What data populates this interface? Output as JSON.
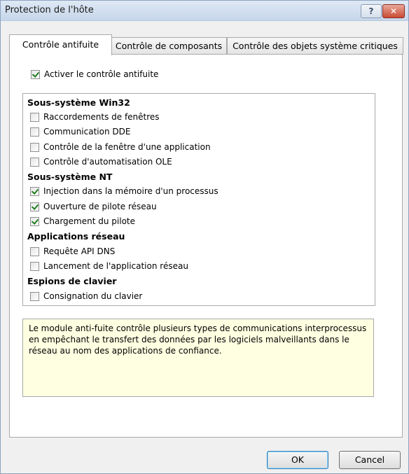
{
  "window": {
    "title": "Protection de l'hôte",
    "help_label": "?",
    "close_label": "✕"
  },
  "tabs": [
    {
      "label": "Contrôle antifuite",
      "active": true
    },
    {
      "label": "Contrôle de composants",
      "active": false
    },
    {
      "label": "Contrôle des objets système critiques",
      "active": false
    }
  ],
  "enable": {
    "label": "Activer le contrôle antifuite",
    "checked": true
  },
  "groups": [
    {
      "title": "Sous-système Win32",
      "items": [
        {
          "label": "Raccordements de fenêtres",
          "checked": false
        },
        {
          "label": "Communication DDE",
          "checked": false
        },
        {
          "label": "Contrôle de la fenêtre d'une application",
          "checked": false
        },
        {
          "label": "Contrôle d'automatisation OLE",
          "checked": false
        }
      ]
    },
    {
      "title": "Sous-système NT",
      "items": [
        {
          "label": "Injection dans la mémoire d'un processus",
          "checked": true
        },
        {
          "label": "Ouverture de pilote réseau",
          "checked": true
        },
        {
          "label": "Chargement du pilote",
          "checked": true
        }
      ]
    },
    {
      "title": "Applications réseau",
      "items": [
        {
          "label": "Requête API DNS",
          "checked": false
        },
        {
          "label": "Lancement de l'application réseau",
          "checked": false
        }
      ]
    },
    {
      "title": "Espions de clavier",
      "items": [
        {
          "label": "Consignation du clavier",
          "checked": false
        }
      ]
    }
  ],
  "description": "Le module anti-fuite contrôle plusieurs types de communications interprocessus en empêchant le transfert des données par les logiciels malveillants dans le réseau au nom des applications de confiance.",
  "buttons": {
    "ok": "OK",
    "cancel": "Cancel"
  }
}
